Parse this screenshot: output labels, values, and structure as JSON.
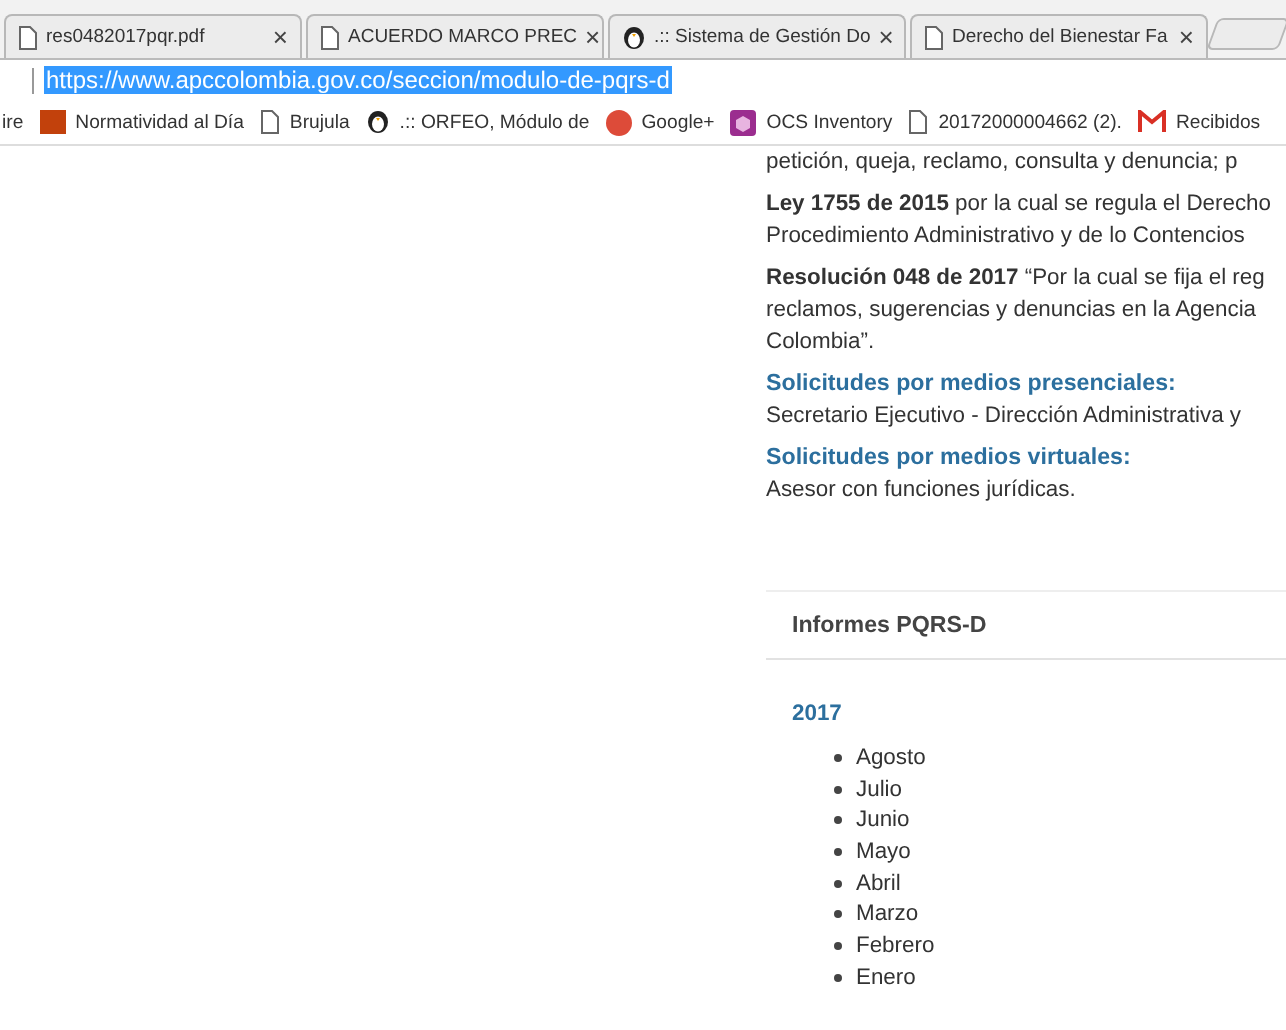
{
  "tabs": [
    {
      "title": "res0482017pqr.pdf",
      "kind": "document",
      "close": "×"
    },
    {
      "title": "ACUERDO MARCO PREC",
      "kind": "document",
      "close": "×"
    },
    {
      "title": ".:: Sistema de Gestión Do",
      "kind": "app",
      "close": "×"
    },
    {
      "title": "Derecho del Bienestar Fa",
      "kind": "document",
      "close": "×"
    }
  ],
  "address_bar": {
    "url": "https://www.apccolombia.gov.co/seccion/modulo-de-pqrs-d",
    "selected": true
  },
  "bookmarks": [
    {
      "label": "ire",
      "kind": "plain"
    },
    {
      "label": "Normatividad al Día",
      "kind": "site"
    },
    {
      "label": "Brujula",
      "kind": "document"
    },
    {
      "label": ".:: ORFEO, Módulo de",
      "kind": "app"
    },
    {
      "label": "Google+",
      "kind": "social"
    },
    {
      "label": "OCS Inventory",
      "kind": "inventory"
    },
    {
      "label": "20172000004662 (2).",
      "kind": "document"
    },
    {
      "label": "Recibidos",
      "kind": "mail"
    }
  ],
  "content": [
    {
      "kind": "paragraph",
      "lines": [
        "petición, queja, reclamo, consulta y denuncia; p"
      ]
    },
    {
      "kind": "paragraph",
      "lines": [
        "**Ley 1755 de 2015** por la cual se regula el Derecho",
        "Procedimiento Administrativo y de lo Contencios"
      ]
    },
    {
      "kind": "paragraph",
      "lines": [
        "**Resolución 048 de 2017** “Por la cual se fija el reg",
        "reclamos, sugerencias y denuncias en la Agencia",
        "Colombia”."
      ]
    },
    {
      "kind": "section",
      "heading": "Solicitudes por medios presenciales:",
      "text": "Secretario Ejecutivo - Dirección Administrativa y"
    },
    {
      "kind": "section",
      "heading": "Solicitudes por medios virtuales:",
      "text": "Asesor con funciones jurídicas."
    }
  ],
  "reports": {
    "title": "Informes PQRS-D",
    "year": "2017",
    "months": [
      "Agosto",
      "Julio",
      "Junio",
      "Mayo",
      "Abril",
      "Marzo",
      "Febrero",
      "Enero"
    ]
  }
}
